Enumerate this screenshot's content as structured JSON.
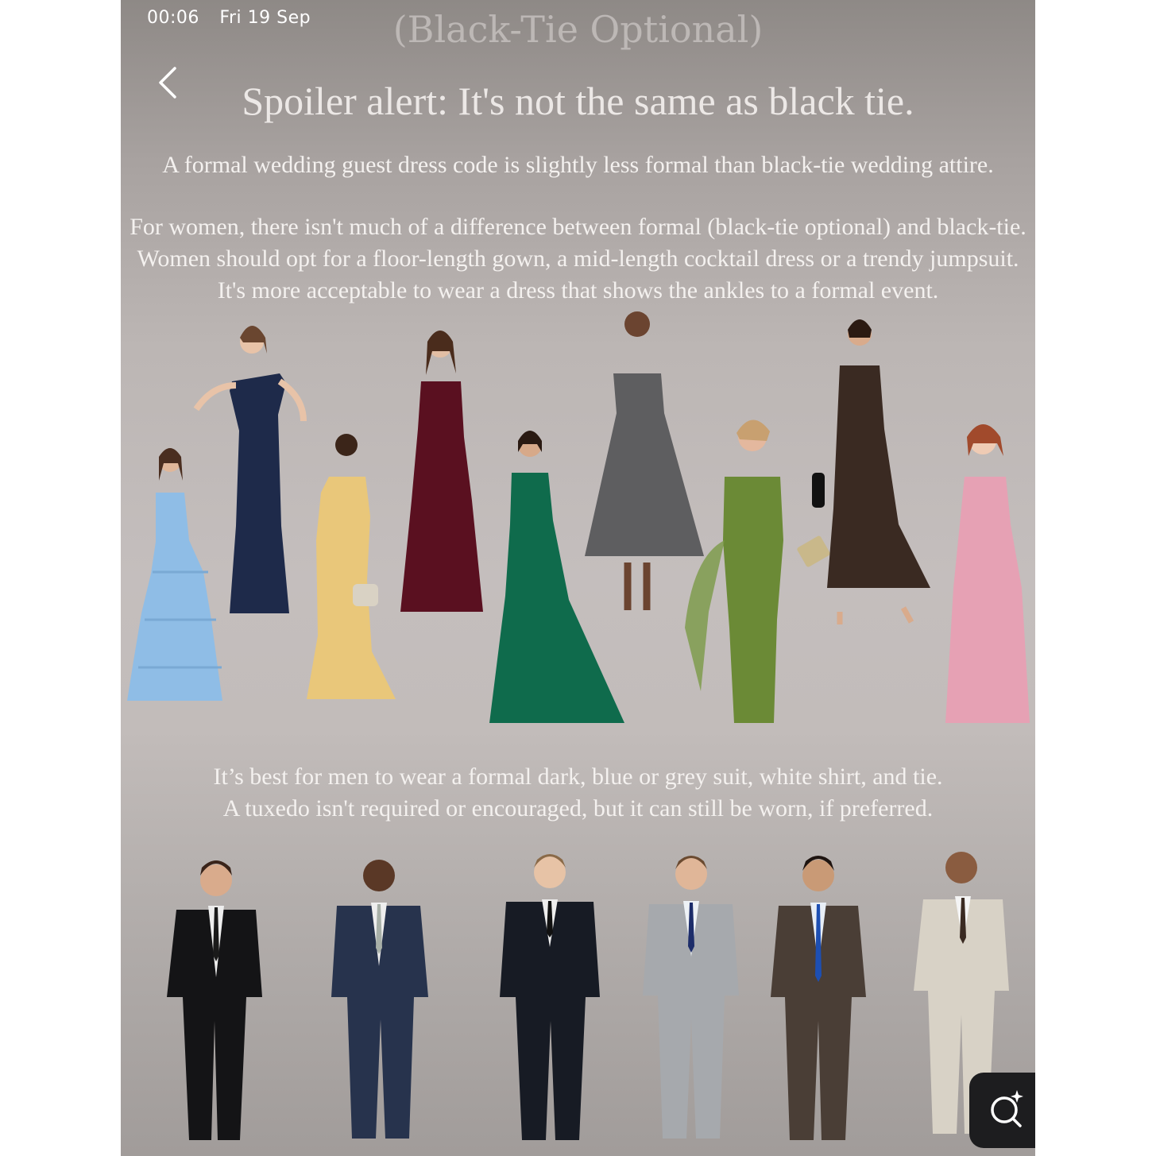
{
  "status_bar": {
    "time": "00:06",
    "date": "Fri 19 Sep"
  },
  "article": {
    "heading_partial": "(Black-Tie Optional)",
    "title": "Spoiler alert: It's not the same as black tie.",
    "intro": "A formal wedding guest dress code is slightly less formal than black-tie wedding attire.",
    "women_lines": [
      "For women, there isn't much of a difference between formal (black-tie optional) and black-tie.",
      "Women should opt for a floor-length gown, a mid-length cocktail dress or a trendy jumpsuit.",
      "It's more acceptable to wear a dress that shows the ankles to a formal event."
    ],
    "men_lines": [
      "It’s best for men to wear a formal dark, blue or grey suit, white shirt, and tie.",
      "A tuxedo isn't required or encouraged, but it can still be worn, if preferred."
    ]
  },
  "women": [
    {
      "dress": "light-blue-tiered-gown",
      "color": "#8fbde6",
      "skin": "#e0b79a",
      "hair": "#4a2e20"
    },
    {
      "dress": "navy-ruffle-gown",
      "color": "#1e2a4a",
      "skin": "#e8c3a8",
      "hair": "#6a4630"
    },
    {
      "dress": "yellow-satin-gown",
      "color": "#e9c77a",
      "skin": "#3b2519",
      "hair": "#1a1010"
    },
    {
      "dress": "burgundy-plunge-gown",
      "color": "#5a1020",
      "skin": "#e2bea4",
      "hair": "#4a2c1c"
    },
    {
      "dress": "emerald-halter-gown",
      "color": "#0f6b4c",
      "skin": "#d7a989",
      "hair": "#2a1a12"
    },
    {
      "dress": "grey-strapless-midi",
      "color": "#5e5e60",
      "skin": "#6b4430",
      "hair": "#1a1210"
    },
    {
      "dress": "olive-draped-gown",
      "color": "#6b8a36",
      "skin": "#e4b89e",
      "hair": "#c8a070"
    },
    {
      "dress": "brown-halter-gown",
      "color": "#3a2a22",
      "skin": "#d9ab8c",
      "hair": "#2b1a12"
    },
    {
      "dress": "pink-pleated-gown",
      "color": "#e6a1b4",
      "skin": "#efcbb4",
      "hair": "#a14a2c"
    }
  ],
  "men": [
    {
      "suit": "black-suit",
      "color": "#141416",
      "tie": "#1a1a1a",
      "skin": "#d9ab8c"
    },
    {
      "suit": "navy-suit",
      "color": "#27334d",
      "tie": "#a8b0a8",
      "skin": "#5a3826"
    },
    {
      "suit": "black-double-breasted",
      "color": "#171b24",
      "tie": "#111111",
      "skin": "#e7c3a6"
    },
    {
      "suit": "light-grey-suit",
      "color": "#a6a9ad",
      "tie": "#1d2d6a",
      "skin": "#e0b698"
    },
    {
      "suit": "brown-suit",
      "color": "#4a3e36",
      "tie": "#1d4fb3",
      "skin": "#c99a76"
    },
    {
      "suit": "cream-suit",
      "color": "#d8d2c6",
      "tie": "#3a2a22",
      "skin": "#8a5c40"
    }
  ],
  "icons": {
    "back": "chevron-left-icon",
    "assistant": "search-sparkle-icon"
  }
}
